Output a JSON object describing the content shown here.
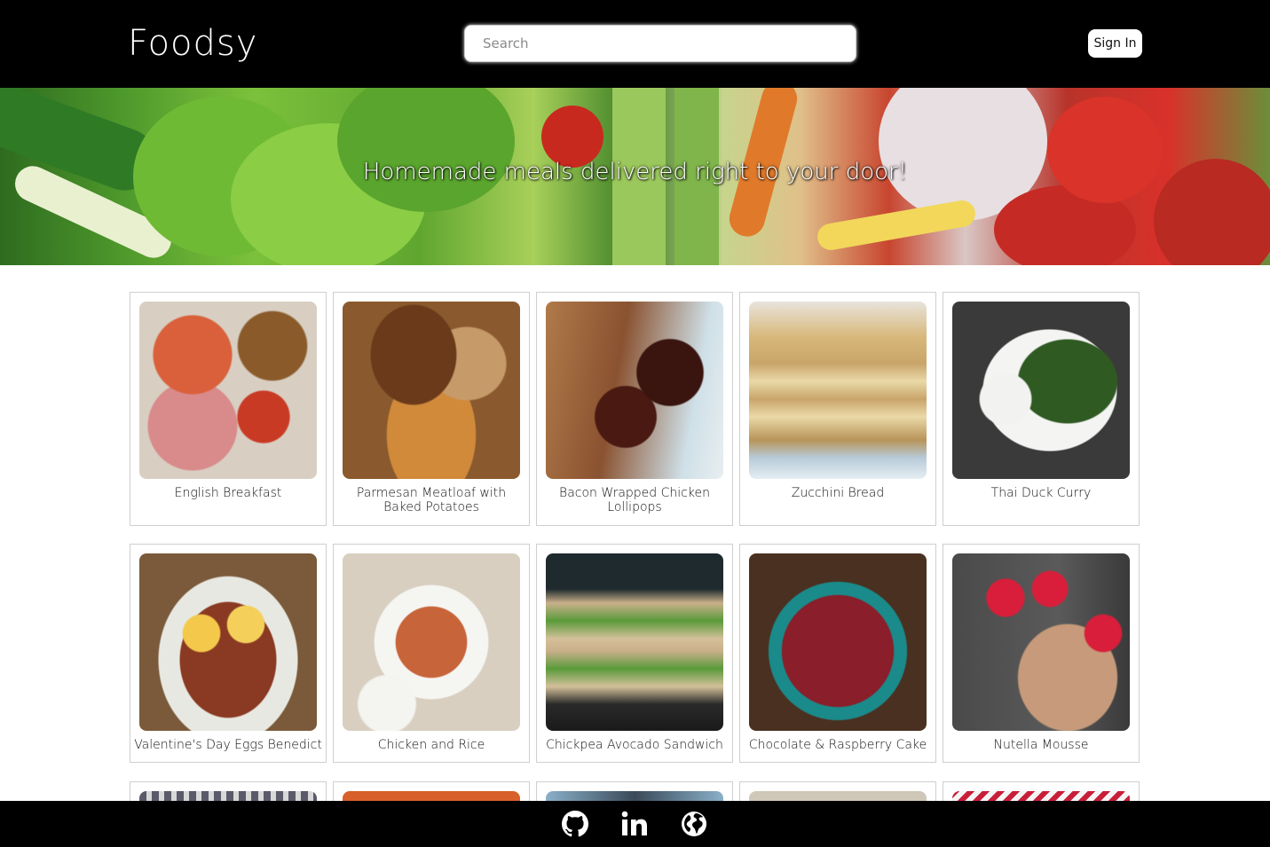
{
  "app": {
    "title": "Foodsy"
  },
  "header": {
    "search_placeholder": "Search",
    "signin_label": "Sign In"
  },
  "hero": {
    "tagline": "Homemade meals delivered right to your door!"
  },
  "meals": [
    {
      "name": "English Breakfast"
    },
    {
      "name": "Parmesan Meatloaf with Baked Potatoes"
    },
    {
      "name": "Bacon Wrapped Chicken Lollipops"
    },
    {
      "name": "Zucchini Bread"
    },
    {
      "name": "Thai Duck Curry"
    },
    {
      "name": "Valentine's Day Eggs Benedict"
    },
    {
      "name": "Chicken and Rice"
    },
    {
      "name": "Chickpea Avocado Sandwich"
    },
    {
      "name": "Chocolate & Raspberry Cake"
    },
    {
      "name": "Nutella Mousse"
    }
  ],
  "footer": {
    "icons": [
      "github-icon",
      "linkedin-icon",
      "globe-icon"
    ]
  }
}
